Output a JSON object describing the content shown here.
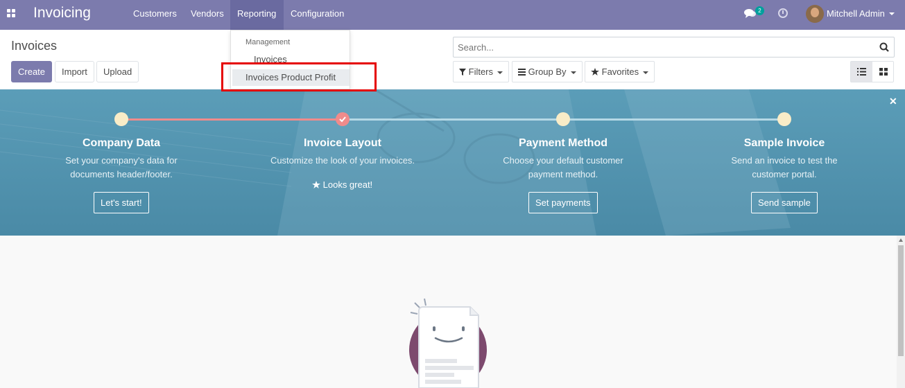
{
  "navbar": {
    "brand": "Invoicing",
    "menu": [
      "Customers",
      "Vendors",
      "Reporting",
      "Configuration"
    ],
    "active_menu": "Reporting",
    "chat_badge": "2",
    "user_name": "Mitchell Admin"
  },
  "control_panel": {
    "breadcrumb": "Invoices",
    "buttons": {
      "create": "Create",
      "import": "Import",
      "upload": "Upload"
    },
    "search_placeholder": "Search...",
    "filters": {
      "filters": "Filters",
      "group_by": "Group By",
      "favorites": "Favorites"
    }
  },
  "dropdown": {
    "header": "Management",
    "items": [
      "Invoices",
      "Invoices Product Profit"
    ]
  },
  "onboarding": {
    "steps": [
      {
        "title": "Company Data",
        "desc_line1": "Set your company's data for",
        "desc_line2": "documents header/footer.",
        "button": "Let's start!"
      },
      {
        "title": "Invoice Layout",
        "desc_line1": "Customize the look of your invoices.",
        "desc_line2": "",
        "button": "Looks great!"
      },
      {
        "title": "Payment Method",
        "desc_line1": "Choose your default customer",
        "desc_line2": "payment method.",
        "button": "Set payments"
      },
      {
        "title": "Sample Invoice",
        "desc_line1": "Send an invoice to test the",
        "desc_line2": "customer portal.",
        "button": "Send sample"
      }
    ]
  },
  "colors": {
    "navbar": "#7c7bad",
    "banner": "#5b9db8",
    "highlight_box": "#e50000",
    "done_step": "#f08b8b",
    "pending_step": "#f9ecc7"
  }
}
